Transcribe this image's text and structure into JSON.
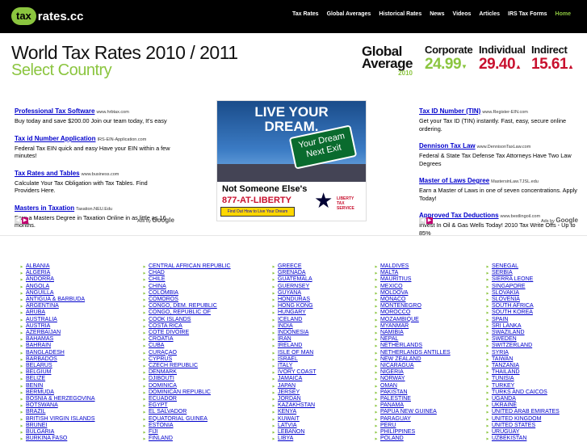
{
  "topbar": {
    "logo_mark": "tax",
    "logo_rest": "rates.cc",
    "nav": [
      "Tax Rates",
      "Global Averages",
      "Historical Rates",
      "News",
      "Videos",
      "Articles",
      "IRS Tax Forms",
      "Home"
    ]
  },
  "header": {
    "title": "World Tax Rates 2010 / 2011",
    "subtitle": "Select Country"
  },
  "rates": {
    "global_line1": "Global",
    "global_line2": "Average",
    "global_year": "2010",
    "corporate_label": "Corporate",
    "corporate_value": "24.99",
    "corporate_trend": "down",
    "individual_label": "Individual",
    "individual_value": "29.40",
    "individual_trend": "up",
    "indirect_label": "Indirect",
    "indirect_value": "15.61",
    "indirect_trend": "up",
    "colors": {
      "green": "#8bc53f",
      "red": "#c8102e",
      "up": "#c8102e",
      "down": "#8bc53f"
    }
  },
  "ads_left": [
    {
      "title": "Professional Tax Software",
      "url": "www.hrbtax.com",
      "body": "Buy today and save $200.00 Join our team today, It's easy"
    },
    {
      "title": "Tax id Number Application",
      "url": "IRS-EIN-Application.com",
      "body": "Federal Tax EIN quick and easy Have your EIN within a few minutes!"
    },
    {
      "title": "Tax Rates and Tables",
      "url": "www.business.com",
      "body": "Calculate Your Tax Obligation with Tax Tables. Find Providers Here."
    },
    {
      "title": "Masters in Taxation",
      "url": "Taxation.NEU.Edu",
      "body": "Earn a Masters Degree in Taxation Online in as little as 16 months."
    }
  ],
  "ads_right": [
    {
      "title": "Tax ID Number (TIN)",
      "url": "www.Register-EIN.com",
      "body": "Get your Tax ID (TIN) instantly. Fast, easy, secure online ordering."
    },
    {
      "title": "Dennison Tax Law",
      "url": "www.DennisonTaxLaw.com",
      "body": "Federal & State Tax Defense Tax Attorneys Have Two Law Degrees"
    },
    {
      "title": "Master of Laws Degree",
      "url": "MastersinLaw.TJSL.edu",
      "body": "Earn a Master of Laws in one of seven concentrations. Apply Today!"
    },
    {
      "title": "Approved Tax Deductions",
      "url": "www.bestlingoil.com",
      "body": "Invest In Oil & Gas Wells Today! 2010 Tax Write Offs - Up to 85%"
    }
  ],
  "ads_by": {
    "prefix": "Ads by",
    "brand": "Google",
    "prev": "◀",
    "next": "▶"
  },
  "banner": {
    "headline_1": "LIVE YOUR",
    "headline_2": "DREAM.",
    "sign_1": "Your Dream",
    "sign_2": "Next Exit",
    "tagline": "Not Someone Else's",
    "phone": "877-AT-LIBERTY",
    "button": "Find Out How to Live Your Dream",
    "logo_1": "LIBERTY",
    "logo_2": "TAX",
    "logo_3": "SERVICE"
  },
  "countries": [
    [
      "ALBANIA",
      "ALGERIA",
      "ANDORRA",
      "ANGOLA",
      "ANGUILLA",
      "ANTIGUA & BARBUDA",
      "ARGENTINA",
      "ARUBA",
      "AUSTRALIA",
      "AUSTRIA",
      "AZERBAIJAN",
      "BAHAMAS",
      "BAHRAIN",
      "BANGLADESH",
      "BARBADOS",
      "BELARUS",
      "BELGIUM",
      "BELIZE",
      "BENIN",
      "BERMUDA",
      "BOSNIA & HERZEGOVINA",
      "BOTSWANA",
      "BRAZIL",
      "BRITISH VIRGIN ISLANDS",
      "BRUNEI",
      "BULGARIA",
      "BURKINA FASO"
    ],
    [
      "CENTRAL AFRICAN REPUBLIC",
      "CHAD",
      "CHILE",
      "CHINA",
      "COLOMBIA",
      "COMOROS",
      "CONGO, DEM. REPUBLIC",
      "CONGO, REPUBLIC OF",
      "COOK ISLANDS",
      "COSTA RICA",
      "COTE DIVOIRE",
      "CROATIA",
      "CUBA",
      "CURAÇAO",
      "CYPRUS",
      "CZECH REPUBLIC",
      "DENMARK",
      "DJIBOUTI",
      "DOMINICA",
      "DOMINICAN REPUBLIC",
      "ECUADOR",
      "EGYPT",
      "EL SALVADOR",
      "EQUATORIAL GUINEA",
      "ESTONIA",
      "FIJI",
      "FINLAND"
    ],
    [
      "GREECE",
      "GRENADA",
      "GUATEMALA",
      "GUERNSEY",
      "GUYANA",
      "HONDURAS",
      "HONG KONG",
      "HUNGARY",
      "ICELAND",
      "INDIA",
      "INDONESIA",
      "IRAN",
      "IRELAND",
      "ISLE OF MAN",
      "ISRAEL",
      "ITALY",
      "IVORY COAST",
      "JAMAICA",
      "JAPAN",
      "JERSEY",
      "JORDAN",
      "KAZAKHSTAN",
      "KENYA",
      "KUWAIT",
      "LATVIA",
      "LEBANON",
      "LIBYA"
    ],
    [
      "MALDIVES",
      "MALTA",
      "MAURITIUS",
      "MEXICO",
      "MOLDOVA",
      "MONACO",
      "MONTENEGRO",
      "MOROCCO",
      "MOZAMBIQUE",
      "MYANMAR",
      "NAMIBIA",
      "NEPAL",
      "NETHERLANDS",
      "NETHERLANDS ANTILLES",
      "NEW ZEALAND",
      "NICARAGUA",
      "NIGERIA",
      "NORWAY",
      "OMAN",
      "PAKISTAN",
      "PALESTINE",
      "PANAMA",
      "PAPUA NEW GUINEA",
      "PARAGUAY",
      "PERU",
      "PHILIPPINES",
      "POLAND"
    ],
    [
      "SENEGAL",
      "SERBIA",
      "SIERRA LEONE",
      "SINGAPORE",
      "SLOVAKIA",
      "SLOVENIA",
      "SOUTH AFRICA",
      "SOUTH KOREA",
      "SPAIN",
      "SRI LANKA",
      "SWAZILAND",
      "SWEDEN",
      "SWITZERLAND",
      "SYRIA",
      "TAIWAN",
      "TANZANIA",
      "THAILAND",
      "TUNISIA",
      "TURKEY",
      "TURKS AND CAICOS",
      "UGANDA",
      "UKRAINE",
      "UNITED ARAB EMIRATES",
      "UNITED KINGDOM",
      "UNITED STATES",
      "URUGUAY",
      "UZBEKISTAN"
    ]
  ]
}
